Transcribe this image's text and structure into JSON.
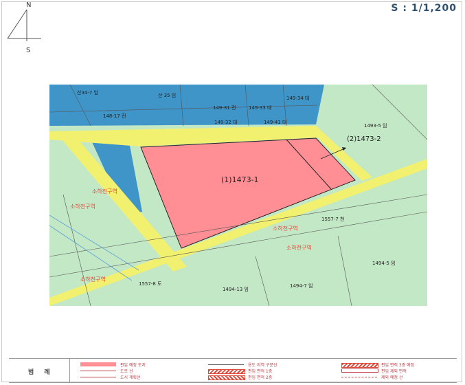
{
  "compass": {
    "north": "N",
    "south": "S"
  },
  "scale": "S : 1/1,200",
  "parcels": {
    "main": "(1)1473-1",
    "secondary": "(2)1473-2"
  },
  "lot_labels": [
    "산34-7 임",
    "산 35 임",
    "149-31 전",
    "149-33 대",
    "149-34 대",
    "148-17 전",
    "149-32 대",
    "149-41 대",
    "1493-5 임",
    "1557-7 천",
    "1494-5 임",
    "1494-7 임",
    "1494-13 임",
    "1557-8 도"
  ],
  "zone_labels": [
    "소하천구역",
    "소하천구역",
    "소하천구역",
    "소하천구역",
    "소하천구역"
  ],
  "legend": {
    "title": "범 례",
    "items": [
      "편입 예정 토지",
      "도로 선",
      "도시 계획선",
      "용도 지역 구분선",
      "편입 면적 1층",
      "편입 면적 2층",
      "편입 면적 3층 예정",
      "편입 제외 면적",
      "제외 예정 선"
    ]
  },
  "colors": {
    "blue_zone": "#3f94c8",
    "green_land": "#c3e8c6",
    "road": "#f2f06f",
    "parcel": "#ff8f95",
    "river_label": "#e04a3a"
  }
}
